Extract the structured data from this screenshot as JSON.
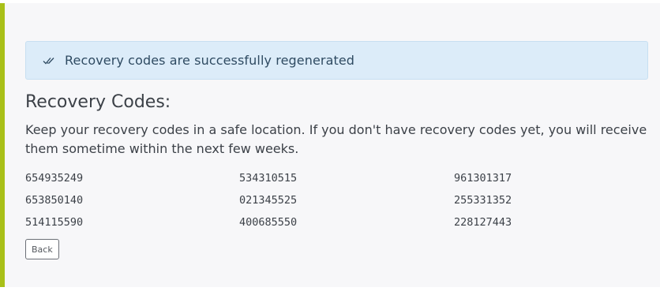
{
  "alert": {
    "icon": "double-check-icon",
    "message": "Recovery codes are successfully regenerated"
  },
  "section": {
    "title": "Recovery Codes:",
    "description": "Keep your recovery codes in a safe location. If you don't have recovery codes yet, you will receive them sometime within the next few weeks."
  },
  "codes": [
    "654935249",
    "534310515",
    "961301317",
    "653850140",
    "021345525",
    "255331352",
    "514115590",
    "400685550",
    "228127443"
  ],
  "actions": {
    "back_label": "Back"
  },
  "colors": {
    "accent_bar": "#a9c018",
    "alert_bg": "#dcecf9",
    "panel_bg": "#f7f7f9"
  }
}
